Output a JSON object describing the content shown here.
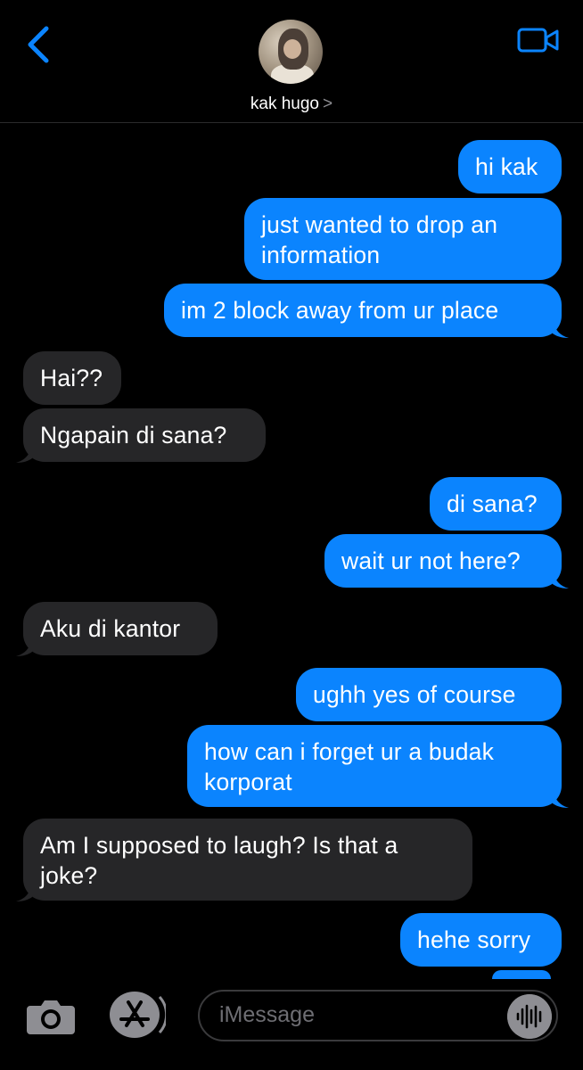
{
  "header": {
    "contact_name": "kak hugo",
    "contact_chevron": ">",
    "back_icon": "chevron-left-icon",
    "video_icon": "video-camera-icon",
    "accent_color": "#0b84fe"
  },
  "messages": [
    {
      "from": "me",
      "text": "hi kak"
    },
    {
      "from": "me",
      "text": "just wanted to drop an information"
    },
    {
      "from": "me",
      "text": "im 2 block away from ur place"
    },
    {
      "from": "them",
      "text": "Hai??"
    },
    {
      "from": "them",
      "text": "Ngapain di sana?"
    },
    {
      "from": "me",
      "text": "di sana?"
    },
    {
      "from": "me",
      "text": "wait ur not here?"
    },
    {
      "from": "them",
      "text": "Aku di kantor"
    },
    {
      "from": "me",
      "text": "ughh yes of course"
    },
    {
      "from": "me",
      "text": "how can i forget ur a budak korporat"
    },
    {
      "from": "them",
      "text": "Am I supposed to laugh? Is that a joke?"
    },
    {
      "from": "me",
      "text": "hehe sorry"
    }
  ],
  "composer": {
    "placeholder": "iMessage",
    "camera_icon": "camera-icon",
    "apps_icon": "app-store-icon",
    "audio_icon": "audio-waveform-icon"
  },
  "colors": {
    "outgoing_bubble": "#0b84fe",
    "incoming_bubble": "#262628",
    "background": "#000000"
  }
}
